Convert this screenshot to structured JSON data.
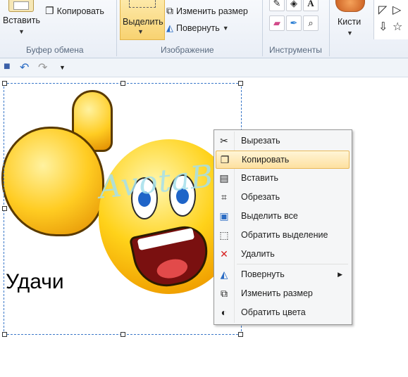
{
  "ribbon": {
    "paste_label": "Вставить",
    "copy_label": "Копировать",
    "clipboard_group": "Буфер обмена",
    "select_label": "Выделить",
    "resize_label": "Изменить размер",
    "rotate_label": "Повернуть",
    "image_group": "Изображение",
    "tools_group": "Инструменты",
    "brushes_label": "Кисти",
    "text_tool": "A"
  },
  "canvas": {
    "caption": "Удачи",
    "watermark": "AvotaBrik"
  },
  "context_menu": {
    "items": [
      {
        "label": "Вырезать",
        "icon": "scissors-icon"
      },
      {
        "label": "Копировать",
        "icon": "copy-icon",
        "highlighted": true
      },
      {
        "label": "Вставить",
        "icon": "paste-icon"
      },
      {
        "label": "Обрезать",
        "icon": "crop-icon"
      },
      {
        "label": "Выделить все",
        "icon": "select-all-icon"
      },
      {
        "label": "Обратить выделение",
        "icon": "invert-selection-icon"
      },
      {
        "label": "Удалить",
        "icon": "delete-icon"
      },
      {
        "label": "Повернуть",
        "icon": "rotate-icon",
        "submenu": true
      },
      {
        "label": "Изменить размер",
        "icon": "resize-icon"
      },
      {
        "label": "Обратить цвета",
        "icon": "invert-colors-icon"
      }
    ]
  },
  "colors": {
    "accent": "#fde0a0",
    "selection_border": "#3b78c9",
    "delete_icon": "#d62020"
  }
}
